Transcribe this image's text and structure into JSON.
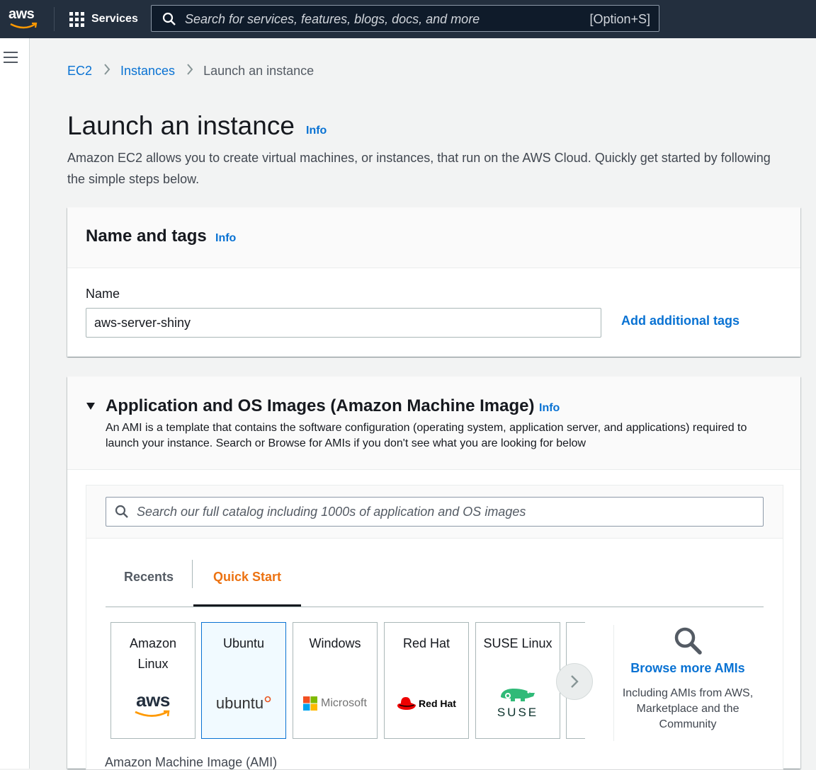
{
  "nav": {
    "logo_text": "aws",
    "services_label": "Services",
    "search_placeholder": "Search for services, features, blogs, docs, and more",
    "search_shortcut": "[Option+S]",
    "bg_color": "#232f3e"
  },
  "breadcrumb": {
    "items": [
      "EC2",
      "Instances"
    ],
    "current": "Launch an instance"
  },
  "page": {
    "title": "Launch an instance",
    "info": "Info",
    "description": "Amazon EC2 allows you to create virtual machines, or instances, that run on the AWS Cloud. Quickly get started by following the simple steps below."
  },
  "name_tags": {
    "title": "Name and tags",
    "info": "Info",
    "name_label": "Name",
    "name_value": "aws-server-shiny",
    "add_tags": "Add additional tags"
  },
  "ami": {
    "title": "Application and OS Images (Amazon Machine Image)",
    "info": "Info",
    "description": "An AMI is a template that contains the software configuration (operating system, application server, and applications) required to launch your instance. Search or Browse for AMIs if you don't see what you are looking for below",
    "search_placeholder": "Search our full catalog including 1000s of application and OS images",
    "tabs": [
      "Recents",
      "Quick Start"
    ],
    "active_tab": "Quick Start",
    "tiles": [
      {
        "name": "Amazon Linux",
        "logo_text": "aws"
      },
      {
        "name": "Ubuntu",
        "logo_text": "ubuntu"
      },
      {
        "name": "Windows",
        "logo_text": "Microsoft"
      },
      {
        "name": "Red Hat",
        "logo_text": "Red Hat"
      },
      {
        "name": "SUSE Linux",
        "logo_text": "SUSE"
      }
    ],
    "selected_tile": "Ubuntu",
    "browse_title": "Browse more AMIs",
    "browse_sub": "Including AMIs from AWS, Marketplace and the Community",
    "ami_label": "Amazon Machine Image (AMI)"
  },
  "colors": {
    "link": "#0972d3",
    "active_tab": "#ec7211",
    "aws_orange": "#ff9900"
  }
}
